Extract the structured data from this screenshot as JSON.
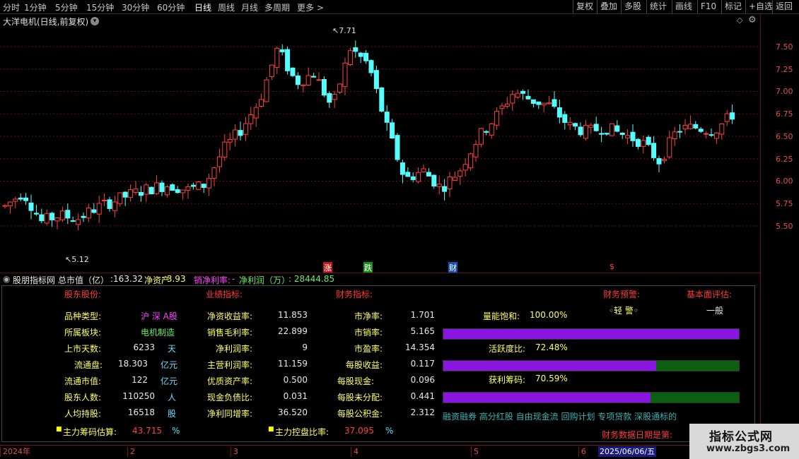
{
  "toolbar": {
    "periods": [
      "分时",
      "1分钟",
      "5分钟",
      "15分钟",
      "30分钟",
      "60分钟",
      "日线",
      "周线",
      "月线",
      "多周期",
      "更多"
    ],
    "more_arrow": ">",
    "right_buttons": [
      "复权",
      "叠加",
      "多股",
      "统计",
      "画线",
      "F10",
      "标记",
      "+自选",
      "返回"
    ]
  },
  "chart": {
    "title": "大洋电机(日线,前复权)",
    "high_label": "7.71",
    "low_label": "5.12",
    "price_ticks": [
      "7.50",
      "7.25",
      "7.00",
      "6.75",
      "6.50",
      "6.25",
      "6.00",
      "5.75",
      "5.50"
    ],
    "event_markers": [
      "涨",
      "跌",
      "财",
      "$"
    ],
    "colors": {
      "up": "#ff4040",
      "down": "#54ffff",
      "grid": "#6a1010"
    }
  },
  "status": {
    "source": "股朋指标网",
    "total_mv_label": "总市值（亿）",
    "total_mv": ":163.32",
    "net_asset_label": "净资产",
    "net_asset": ": 3.93",
    "net_margin_label": "销净利率:",
    "net_margin": "-",
    "net_profit_label": "净利润（万）",
    "net_profit": ": 28444.85"
  },
  "panel": {
    "headers": {
      "shareholder": "股东股份:",
      "performance": "业绩指标:",
      "finance": "财务指标:",
      "warning": "财务预警:",
      "fundamental": "基本面评估:"
    },
    "warning_value": "◦轻 警◦",
    "fundamental_value": "一般",
    "col1": [
      {
        "label": "品种类型:",
        "value": "沪 深 A股",
        "unit": ""
      },
      {
        "label": "所属板块:",
        "value": "电机制造",
        "unit": ""
      },
      {
        "label": "上市天数:",
        "value": "6233",
        "unit": "天"
      },
      {
        "label": "流通盘:",
        "value": "18.303",
        "unit": "亿元"
      },
      {
        "label": "流通市值:",
        "value": "122",
        "unit": "亿元"
      },
      {
        "label": "股东人数:",
        "value": "110250",
        "unit": "人"
      },
      {
        "label": "人均持股:",
        "value": "16518",
        "unit": "股"
      }
    ],
    "col2": [
      {
        "label": "净资收益率:",
        "value": "11.853"
      },
      {
        "label": "销售毛利率:",
        "value": "22.899"
      },
      {
        "label": "净利润率:",
        "value": "9"
      },
      {
        "label": "主营利润率:",
        "value": "11.159"
      },
      {
        "label": "优质资产率:",
        "value": "0.500"
      },
      {
        "label": "现金负债比:",
        "value": "0.031"
      },
      {
        "label": "净利同增率:",
        "value": "36.520"
      }
    ],
    "col3": [
      {
        "label": "市净率:",
        "value": "1.701"
      },
      {
        "label": "市销率:",
        "value": "5.165"
      },
      {
        "label": "市盈率:",
        "value": "14.354"
      },
      {
        "label": "每股收益:",
        "value": "0.117"
      },
      {
        "label": "每股现金:",
        "value": "0.096"
      },
      {
        "label": "每股未分配:",
        "value": "0.441"
      },
      {
        "label": "每股公积金:",
        "value": "2.312"
      }
    ],
    "bars": [
      {
        "label": "量能饱和:",
        "value": "100.00%",
        "fill": 1.0
      },
      {
        "label": "活跃度比:",
        "value": "72.48%",
        "fill": 0.72
      },
      {
        "label": "获利筹码:",
        "value": "70.59%",
        "fill": 0.7
      }
    ],
    "concepts": "融资融券 高分红股 自由现金流 回购计划 专项贷款 深股通标的",
    "main_chip_label": "主力筹码估算:",
    "main_chip_value": "43.715",
    "main_chip_unit": "%",
    "main_control_label": "主力控盘比率:",
    "main_control_value": "37.095",
    "main_control_unit": "%",
    "report_date_label": "财务数据日期是第:"
  },
  "date_axis": {
    "labels": [
      "2024年",
      "2",
      "3",
      "4",
      "5",
      "6"
    ],
    "cursor": "2025/06/06/五"
  },
  "watermark": {
    "title": "指标公式网",
    "url": "www.zbgs3.com"
  }
}
